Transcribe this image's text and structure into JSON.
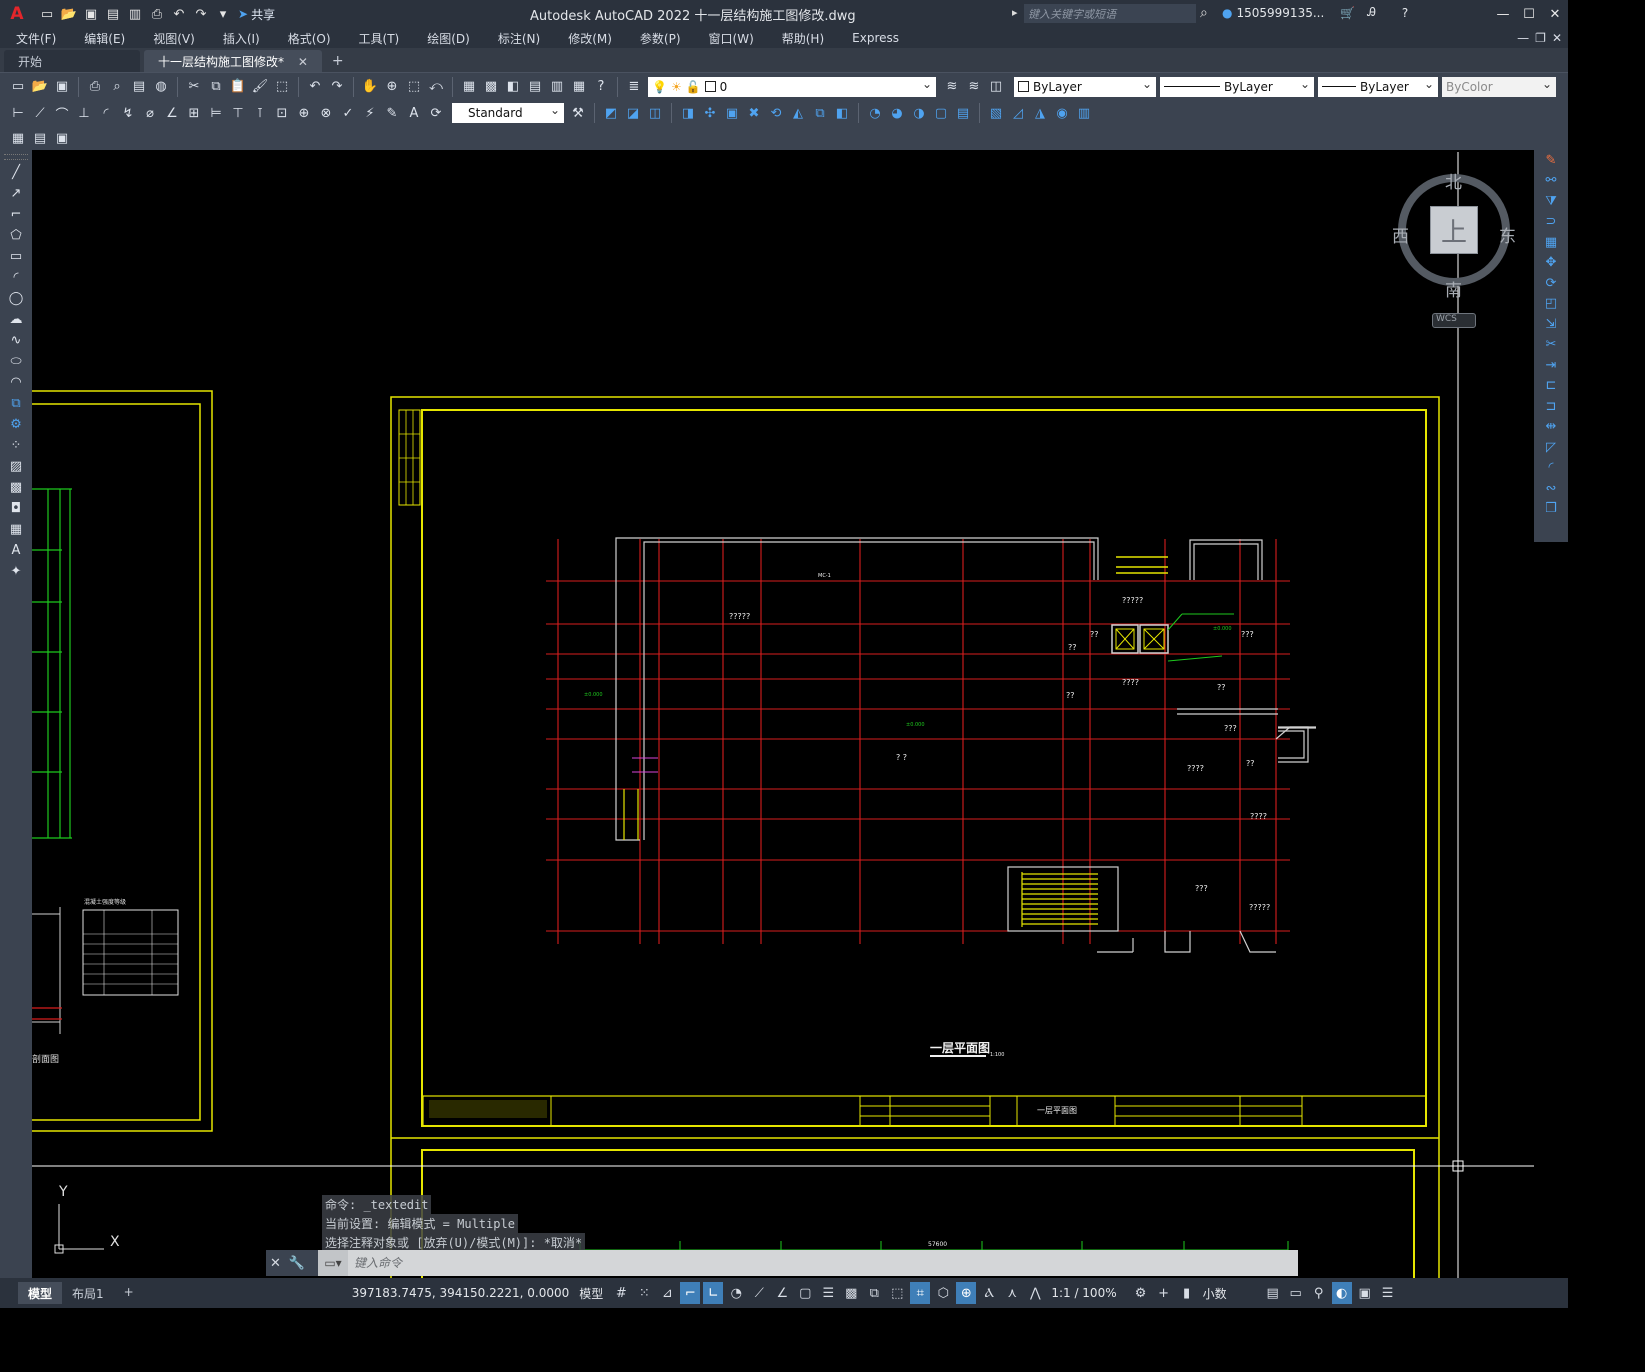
{
  "titlebar": {
    "app_logo": "A",
    "share_label": "共享",
    "window_title": "Autodesk AutoCAD 2022    十一层结构施工图修改.dwg",
    "search_placeholder": "键入关键字或短语",
    "user": "1505999135..."
  },
  "menu": [
    "文件(F)",
    "编辑(E)",
    "视图(V)",
    "插入(I)",
    "格式(O)",
    "工具(T)",
    "绘图(D)",
    "标注(N)",
    "修改(M)",
    "参数(P)",
    "窗口(W)",
    "帮助(H)",
    "Express"
  ],
  "tabs": [
    {
      "label": "开始",
      "active": false
    },
    {
      "label": "十一层结构施工图修改*",
      "active": true
    }
  ],
  "toolbar": {
    "layer_value": "0",
    "color_value": "ByLayer",
    "linetype_value": "ByLayer",
    "lineweight_value": "ByLayer",
    "plotstyle_value": "ByColor",
    "style_value": "Standard"
  },
  "viewcube": {
    "north": "北",
    "south": "南",
    "east": "东",
    "west": "西",
    "top": "上",
    "wcs": "WCS"
  },
  "drawing": {
    "plan_title": "一层平面图",
    "plan_scale": "1:100",
    "titleblock_name": "一层平面图",
    "left_table_title": "混凝土强度等级",
    "dim_total": "57600",
    "labels": {
      "mc1": "MC-1",
      "q1": "?????",
      "q2": "????",
      "q3": "???",
      "q4": "??",
      "q5": "? ?",
      "elev": "±0.000"
    },
    "left_section_label": "剖面图"
  },
  "ucs": {
    "x": "X",
    "y": "Y"
  },
  "command": {
    "history": [
      "命令: _textedit",
      "当前设置: 编辑模式 = Multiple",
      "选择注释对象或 [放弃(U)/模式(M)]: *取消*"
    ],
    "placeholder": "键入命令"
  },
  "status": {
    "layout_tabs": [
      {
        "label": "模型",
        "active": true
      },
      {
        "label": "布局1",
        "active": false
      }
    ],
    "coords": "397183.7475, 394150.2221, 0.0000",
    "model": "模型",
    "scale": "1:1 / 100%",
    "units": "小数"
  },
  "colors": {
    "frame": "#e6e600",
    "grid_red": "#d81e1e",
    "wall": "#d0d0d0",
    "green": "#1ec81e",
    "accent_blue": "#3f7fb8"
  }
}
